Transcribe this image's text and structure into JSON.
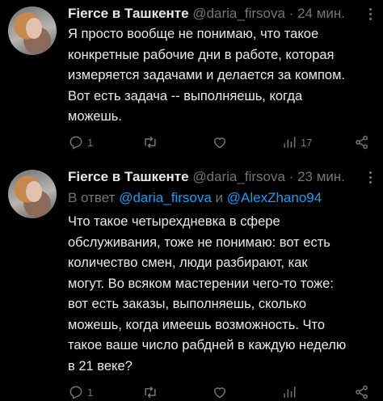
{
  "tweets": [
    {
      "author": "Fierce в Ташкенте",
      "handle": "@daria_firsova",
      "separator": "·",
      "time": "24 мин.",
      "text_lines": [
        "Я просто вообще не понимаю, что такое",
        "конкретные рабочие дни в работе, которая",
        "измеряется задачами и делается за компом.",
        "Вот есть задача -- выполняешь, когда",
        "можешь."
      ],
      "actions": {
        "reply_count": "1",
        "retweet_count": "",
        "like_count": "",
        "views_count": "17"
      }
    },
    {
      "author": "Fierce в Ташкенте",
      "handle": "@daria_firsova",
      "separator": "·",
      "time": "23 мин.",
      "reply_to": {
        "prefix": "В ответ",
        "mention_1": "@daria_firsova",
        "conjunction": "и",
        "mention_2": "@AlexZhano94"
      },
      "text_lines": [
        "Что такое четырехдневка в сфере",
        "обслуживания, тоже не понимаю: вот есть",
        "количество смен, люди разбирают, как",
        "могут. Во всяком мастерении чего-то тоже:",
        "вот есть заказы, выполняешь, сколько",
        "можешь, когда имеешь возможность. Что",
        "такое ваше число рабдней в каждую неделю",
        "в 21 веке?"
      ],
      "actions": {
        "reply_count": "1",
        "retweet_count": "",
        "like_count": "",
        "views_count": ""
      }
    }
  ]
}
